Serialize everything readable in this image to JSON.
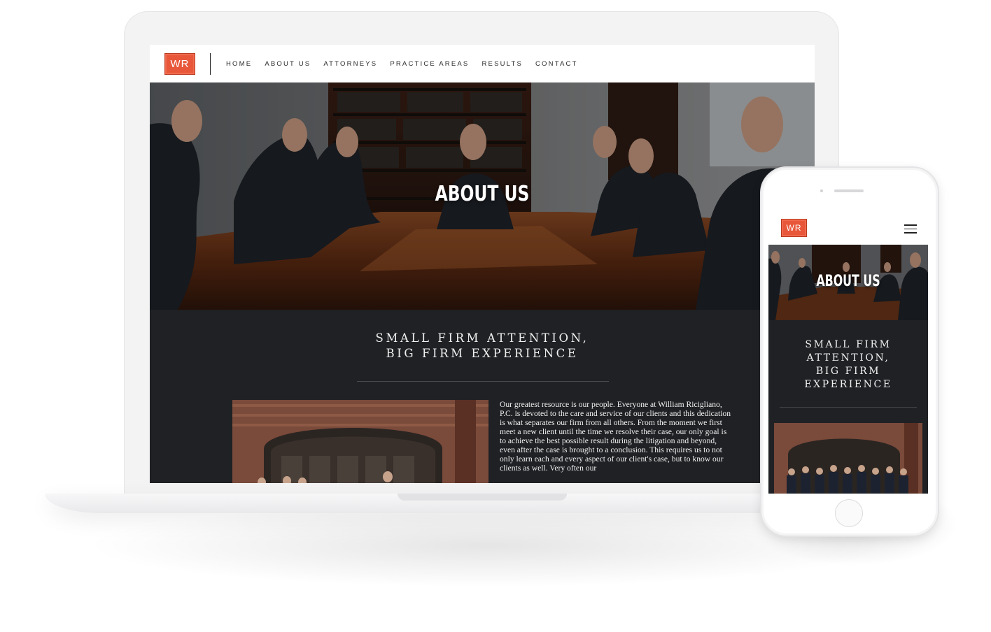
{
  "site": {
    "logo_text": "WR",
    "brand_color": "#e8573a"
  },
  "nav": {
    "items": [
      "HOME",
      "ABOUT US",
      "ATTORNEYS",
      "PRACTICE AREAS",
      "RESULTS",
      "CONTACT"
    ]
  },
  "hero": {
    "title": "ABOUT US"
  },
  "tagline": {
    "line1": "SMALL FIRM ATTENTION,",
    "line2": "BIG FIRM EXPERIENCE"
  },
  "mobile_tagline": {
    "line1": "SMALL FIRM",
    "line2": "ATTENTION,",
    "line3": "BIG FIRM",
    "line4": "EXPERIENCE"
  },
  "body_text": "Our greatest resource is our people. Everyone at William Ricigliano, P.C. is devoted to the care and service of our clients and this dedication is what separates our firm from all others. From the moment we first meet a new client until the time we resolve their case, our only goal is to achieve the best possible result during the litigation and beyond, even after the case is brought to a conclusion. This requires us to not only learn each and every aspect of our client's case, but to know our clients as well. Very often our",
  "icons": {
    "menu": "hamburger-menu-icon"
  }
}
